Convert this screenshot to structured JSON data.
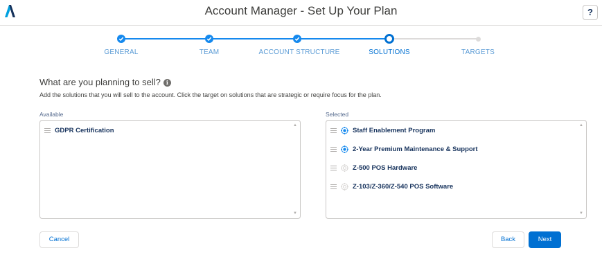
{
  "header": {
    "title": "Account Manager - Set Up Your Plan",
    "help_label": "?"
  },
  "steps": [
    {
      "label": "GENERAL",
      "status": "complete"
    },
    {
      "label": "TEAM",
      "status": "complete"
    },
    {
      "label": "ACCOUNT STRUCTURE",
      "status": "complete"
    },
    {
      "label": "SOLUTIONS",
      "status": "current"
    },
    {
      "label": "TARGETS",
      "status": "incomplete"
    }
  ],
  "main": {
    "question": "What are you planning to sell?",
    "info_icon_glyph": "i",
    "description": "Add the solutions that you will sell to the account. Click the target on solutions that are strategic or require focus for the plan."
  },
  "available": {
    "label": "Available",
    "items": [
      {
        "label": "GDPR Certification"
      }
    ]
  },
  "selected": {
    "label": "Selected",
    "items": [
      {
        "label": "Staff Enablement Program",
        "targeted": true
      },
      {
        "label": "2-Year Premium Maintenance & Support",
        "targeted": true
      },
      {
        "label": "Z-500 POS Hardware",
        "targeted": false
      },
      {
        "label": "Z-103/Z-360/Z-540 POS Software",
        "targeted": false
      }
    ]
  },
  "footer": {
    "cancel_label": "Cancel",
    "back_label": "Back",
    "next_label": "Next"
  },
  "colors": {
    "brand": "#0070d2",
    "step_complete": "#1589ee",
    "target_active": "#1589ee",
    "target_inactive": "#c9c7c5",
    "logo": "#032e61",
    "logo_accent": "#00a1e0"
  }
}
